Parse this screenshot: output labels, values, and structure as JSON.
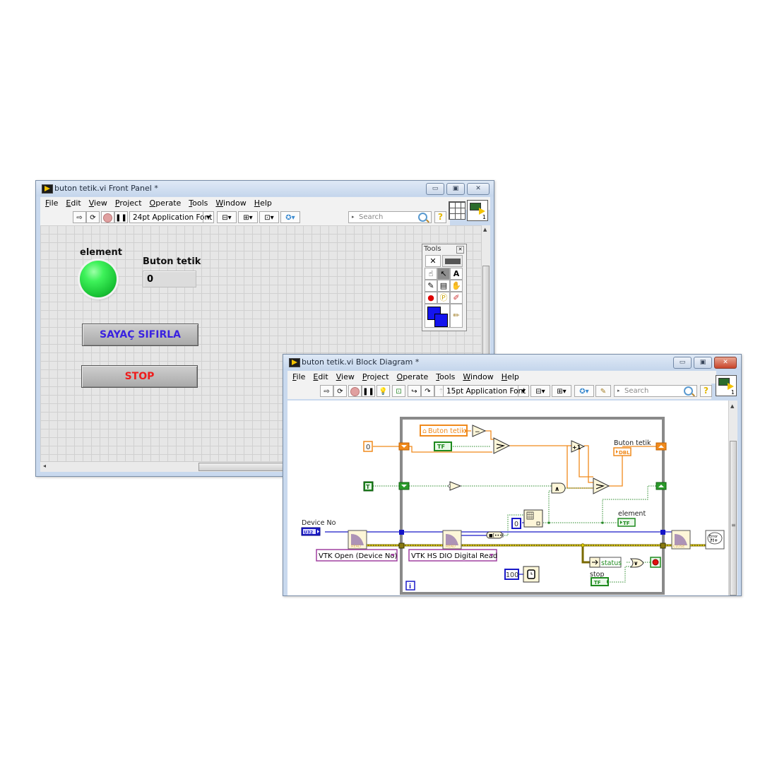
{
  "front_panel": {
    "title": "buton tetik.vi Front Panel *",
    "menu": [
      "File",
      "Edit",
      "View",
      "Project",
      "Operate",
      "Tools",
      "Window",
      "Help"
    ],
    "toolbar": {
      "font_select": "24pt Application Font",
      "search_placeholder": "Search",
      "help_glyph": "?",
      "vi_icon_number": "1"
    },
    "window_buttons": {
      "minimize": "▭",
      "maximize": "▣",
      "close": "✕"
    },
    "controls": {
      "led_label": "element",
      "led_state": "on",
      "led_color": "#2ee04a",
      "indicator_label": "Buton tetik",
      "indicator_value": "0",
      "reset_button_label": "SAYAÇ SIFIRLA",
      "reset_button_color": "#3a22e0",
      "stop_button_label": "STOP",
      "stop_button_color": "#ee1c1c"
    },
    "tools_palette": {
      "title": "Tools",
      "close_glyph": "✕",
      "tools": [
        "automatic-tool",
        "operate-tool",
        "position-tool",
        "text-tool",
        "connect-wire-tool",
        "shortcut-menu-tool",
        "scroll-tool",
        "breakpoint-tool",
        "probe-tool",
        "color-copy-tool",
        "set-color-tool",
        "color-brush-tool"
      ]
    }
  },
  "block_diagram": {
    "title": "buton tetik.vi Block Diagram *",
    "menu": [
      "File",
      "Edit",
      "View",
      "Project",
      "Operate",
      "Tools",
      "Window",
      "Help"
    ],
    "toolbar": {
      "font_select": "15pt Application Font",
      "search_placeholder": "Search",
      "help_glyph": "?",
      "vi_icon_number": "1"
    },
    "window_buttons": {
      "minimize": "▭",
      "maximize": "▣",
      "close": "✕"
    },
    "nodes": {
      "const_zero": "0",
      "const_true": "T",
      "local_var": "Buton tetik",
      "tf_const": "TF",
      "decrement": "−",
      "increment": "+1",
      "and_op": "∧",
      "or_op": "∨",
      "not_op": "¬",
      "indicator_label": "Buton tetik",
      "indicator_type": "DBL",
      "led_terminal_label": "element",
      "led_terminal_type": "TF",
      "device_no_label": "Device No",
      "device_no_type": "U32",
      "vtk_open": "VTK Open (Device No)",
      "vtk_read": "VTK HS DIO Digital Read",
      "read_glyph": "READ",
      "close_glyph": "CLOSE",
      "index_const": "0",
      "wait_ms": "100",
      "status_label": "status",
      "stop_label": "stop",
      "stop_type": "TF",
      "iteration": "i",
      "error_handler": "Error ?!+"
    },
    "colors": {
      "orange_wire": "#f08a1c",
      "green_wire": "#2a8a2a",
      "blue_wire": "#1a1ac8",
      "error_wire": "#d8c800",
      "loop_border": "#8a8a8a",
      "vi_node": "#fdf6d8"
    }
  }
}
